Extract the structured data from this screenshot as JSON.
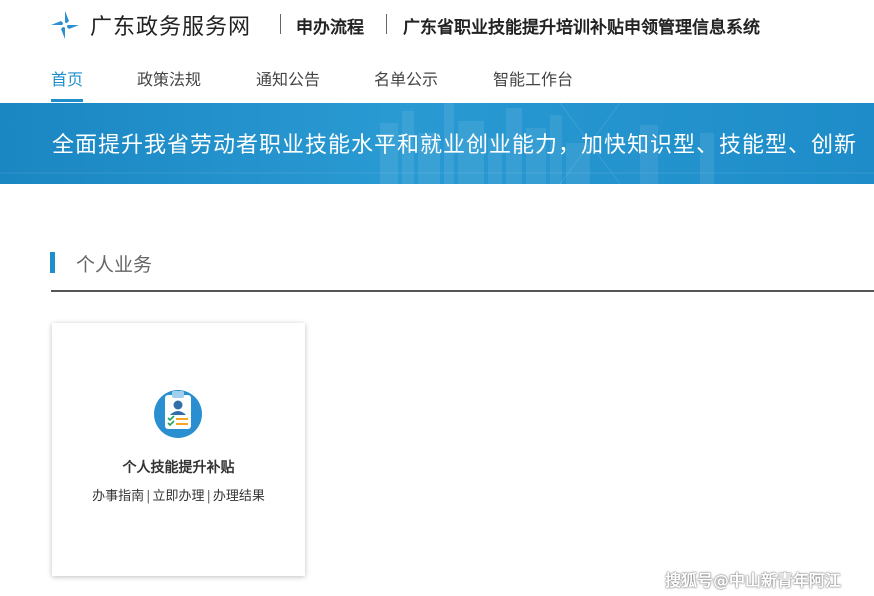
{
  "header": {
    "site_name": "广东政务服务网",
    "flow_label": "申办流程",
    "system_name": "广东省职业技能提升培训补贴申领管理信息系统"
  },
  "nav": {
    "items": [
      "首页",
      "政策法规",
      "通知公告",
      "名单公示",
      "智能工作台"
    ],
    "active": "首页"
  },
  "banner": {
    "text": "全面提升我省劳动者职业技能水平和就业创业能力，加快知识型、技能型、创新"
  },
  "section": {
    "title": "个人业务"
  },
  "card": {
    "title": "个人技能提升补贴",
    "links": [
      "办事指南",
      "立即办理",
      "办理结果"
    ],
    "separator": "|"
  },
  "watermark": "搜狐号@中山新青年阿江",
  "colors": {
    "accent": "#1f8fcc",
    "banner": "#2a9ad3"
  }
}
